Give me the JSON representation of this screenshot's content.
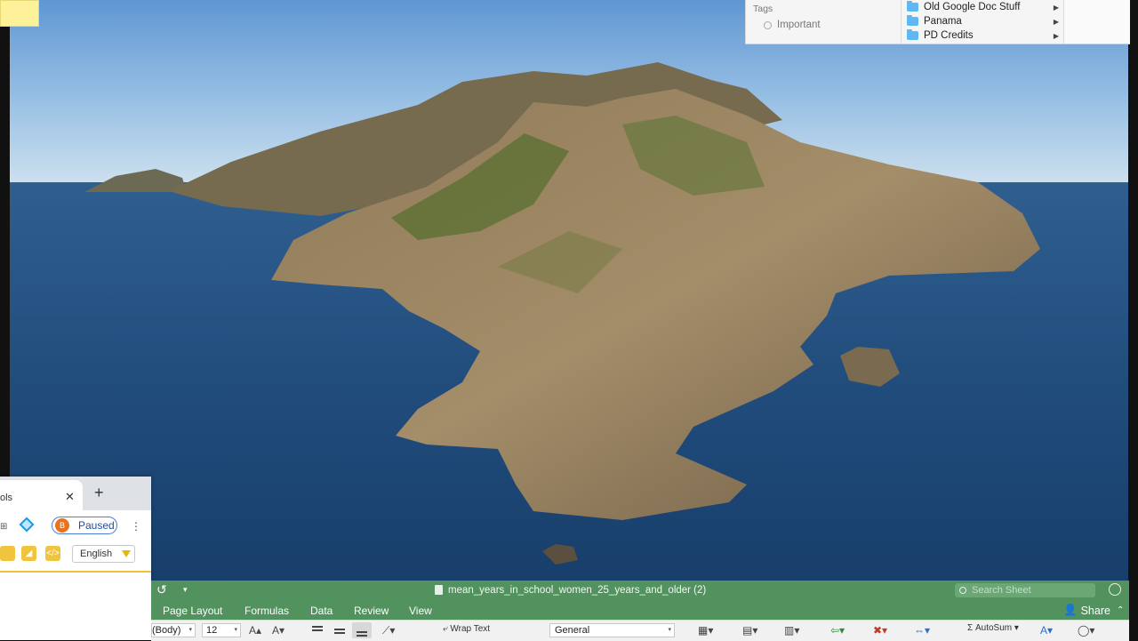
{
  "finder_menu": {
    "tags_label": "Tags",
    "tag_items": [
      "Important"
    ],
    "folders": [
      "Old Google Doc Stuff",
      "Panama",
      "PD Credits"
    ]
  },
  "extension_popup": {
    "tab_title": "ols",
    "paused_label": "Paused",
    "avatar_letter": "B",
    "language": "English"
  },
  "excel": {
    "document_title": "mean_years_in_school_women_25_years_and_older (2)",
    "search_placeholder": "Search Sheet",
    "tabs": [
      "Page Layout",
      "Formulas",
      "Data",
      "Review",
      "View"
    ],
    "share_label": "Share",
    "font_name": "(Body)",
    "font_size": "12",
    "wrap_text_label": "Wrap Text",
    "number_format": "General",
    "autosum_label": "AutoSum",
    "colors": {
      "title_bar": "#52925e"
    }
  },
  "wallpaper": {
    "icon": "island-landscape-icon"
  }
}
